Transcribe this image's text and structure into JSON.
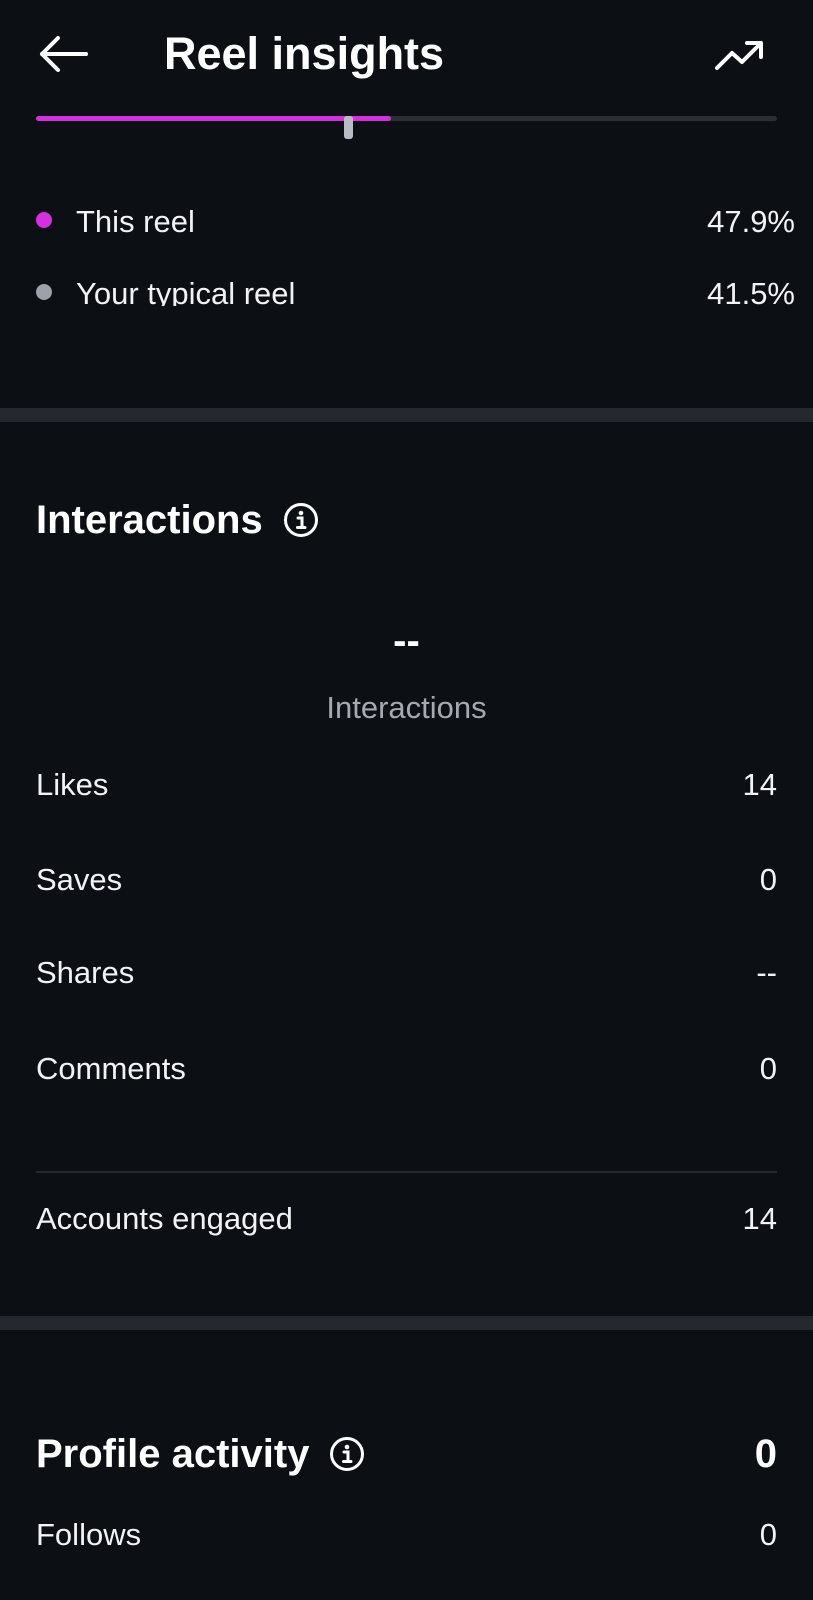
{
  "header": {
    "title": "Reel insights",
    "back_icon": "arrow-left-icon",
    "trend_icon": "trending-up-icon"
  },
  "retention": {
    "this_reel_fraction": 0.479,
    "typical_reel_fraction": 0.415,
    "fill_color": "#d62fe0",
    "marker_color": "#b8bcc4",
    "legend": [
      {
        "label": "This reel",
        "value": "47.9%",
        "color": "#d62fe0"
      },
      {
        "label": "Your typical reel",
        "value": "41.5%",
        "color": "#9da1a9"
      }
    ]
  },
  "interactions": {
    "title": "Interactions",
    "info_icon": "info-icon",
    "total_value": "--",
    "total_label": "Interactions",
    "rows": [
      {
        "label": "Likes",
        "value": "14"
      },
      {
        "label": "Saves",
        "value": "0"
      },
      {
        "label": "Shares",
        "value": "--"
      },
      {
        "label": "Comments",
        "value": "0"
      }
    ],
    "accounts_engaged": {
      "label": "Accounts engaged",
      "value": "14"
    }
  },
  "profile_activity": {
    "title": "Profile activity",
    "info_icon": "info-icon",
    "total_value": "0",
    "rows": [
      {
        "label": "Follows",
        "value": "0"
      }
    ]
  }
}
